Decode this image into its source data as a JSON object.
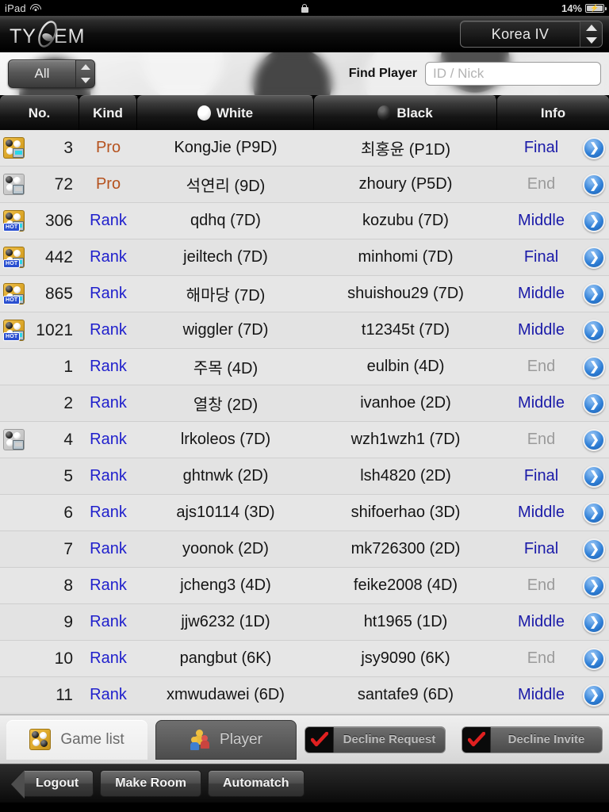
{
  "statusbar": {
    "device": "iPad",
    "wifi_icon": "wifi-icon",
    "lock_icon": "lock-icon",
    "battery_percent": "14%",
    "battery_icon": "battery-charging-icon"
  },
  "header": {
    "logo_text": "TYGEM",
    "server_select": {
      "value": "Korea IV"
    }
  },
  "filterbar": {
    "room_filter": {
      "value": "All"
    },
    "find_label": "Find Player",
    "find_input": {
      "value": "",
      "placeholder": "ID / Nick"
    }
  },
  "table": {
    "columns": [
      "No.",
      "Kind",
      "White",
      "Black",
      "Info"
    ],
    "white_stone_icon": "white-stone-icon",
    "black_stone_icon": "black-stone-icon",
    "arrow_icon": "chevron-right-icon",
    "rows": [
      {
        "icon": "board-color",
        "hot": false,
        "no": "3",
        "kind": "Pro",
        "white": "KongJie (P9D)",
        "black": "최홍윤 (P1D)",
        "info": "Final",
        "info_state": "active"
      },
      {
        "icon": "board-gray",
        "hot": false,
        "no": "72",
        "kind": "Pro",
        "white": "석연리 (9D)",
        "black": "zhoury (P5D)",
        "info": "End",
        "info_state": "end"
      },
      {
        "icon": "board-color",
        "hot": true,
        "no": "306",
        "kind": "Rank",
        "white": "qdhq (7D)",
        "black": "kozubu (7D)",
        "info": "Middle",
        "info_state": "active"
      },
      {
        "icon": "board-color",
        "hot": true,
        "no": "442",
        "kind": "Rank",
        "white": "jeiltech (7D)",
        "black": "minhomi (7D)",
        "info": "Final",
        "info_state": "active"
      },
      {
        "icon": "board-color",
        "hot": true,
        "no": "865",
        "kind": "Rank",
        "white": "해마당 (7D)",
        "black": "shuishou29 (7D)",
        "info": "Middle",
        "info_state": "active"
      },
      {
        "icon": "board-color",
        "hot": true,
        "no": "1021",
        "kind": "Rank",
        "white": "wiggler (7D)",
        "black": "t12345t (7D)",
        "info": "Middle",
        "info_state": "active"
      },
      {
        "icon": "none",
        "hot": false,
        "no": "1",
        "kind": "Rank",
        "white": "주목 (4D)",
        "black": "eulbin (4D)",
        "info": "End",
        "info_state": "end"
      },
      {
        "icon": "none",
        "hot": false,
        "no": "2",
        "kind": "Rank",
        "white": "열창 (2D)",
        "black": "ivanhoe (2D)",
        "info": "Middle",
        "info_state": "active"
      },
      {
        "icon": "board-gray",
        "hot": false,
        "no": "4",
        "kind": "Rank",
        "white": "lrkoleos (7D)",
        "black": "wzh1wzh1 (7D)",
        "info": "End",
        "info_state": "end"
      },
      {
        "icon": "none",
        "hot": false,
        "no": "5",
        "kind": "Rank",
        "white": "ghtnwk (2D)",
        "black": "lsh4820 (2D)",
        "info": "Final",
        "info_state": "active"
      },
      {
        "icon": "none",
        "hot": false,
        "no": "6",
        "kind": "Rank",
        "white": "ajs10114 (3D)",
        "black": "shifoerhao (3D)",
        "info": "Middle",
        "info_state": "active"
      },
      {
        "icon": "none",
        "hot": false,
        "no": "7",
        "kind": "Rank",
        "white": "yoonok (2D)",
        "black": "mk726300 (2D)",
        "info": "Final",
        "info_state": "active"
      },
      {
        "icon": "none",
        "hot": false,
        "no": "8",
        "kind": "Rank",
        "white": "jcheng3 (4D)",
        "black": "feike2008 (4D)",
        "info": "End",
        "info_state": "end"
      },
      {
        "icon": "none",
        "hot": false,
        "no": "9",
        "kind": "Rank",
        "white": "jjw6232 (1D)",
        "black": "ht1965 (1D)",
        "info": "Middle",
        "info_state": "active"
      },
      {
        "icon": "none",
        "hot": false,
        "no": "10",
        "kind": "Rank",
        "white": "pangbut (6K)",
        "black": "jsy9090 (6K)",
        "info": "End",
        "info_state": "end"
      },
      {
        "icon": "none",
        "hot": false,
        "no": "11",
        "kind": "Rank",
        "white": "xmwudawei (6D)",
        "black": "santafe9 (6D)",
        "info": "Middle",
        "info_state": "active"
      }
    ],
    "hot_badge": "HOT"
  },
  "tabbar": {
    "tabs": [
      {
        "label": "Game list",
        "icon": "go-board-icon",
        "selected": true
      },
      {
        "label": "Player",
        "icon": "people-icon",
        "selected": false
      }
    ],
    "toggles": [
      {
        "label": "Decline Request",
        "checked": true,
        "check_icon": "check-icon"
      },
      {
        "label": "Decline Invite",
        "checked": true,
        "check_icon": "check-icon"
      }
    ]
  },
  "bottombar": {
    "buttons": [
      {
        "label": "Logout",
        "style": "back"
      },
      {
        "label": "Make Room",
        "style": "normal"
      },
      {
        "label": "Automatch",
        "style": "normal"
      }
    ]
  },
  "colors": {
    "accent_blue": "#1a1aa8",
    "pro_orange": "#b5521e",
    "rank_blue": "#2020cc",
    "end_gray": "#9b9b9b",
    "arrow_blue": "#2f7fd6"
  }
}
